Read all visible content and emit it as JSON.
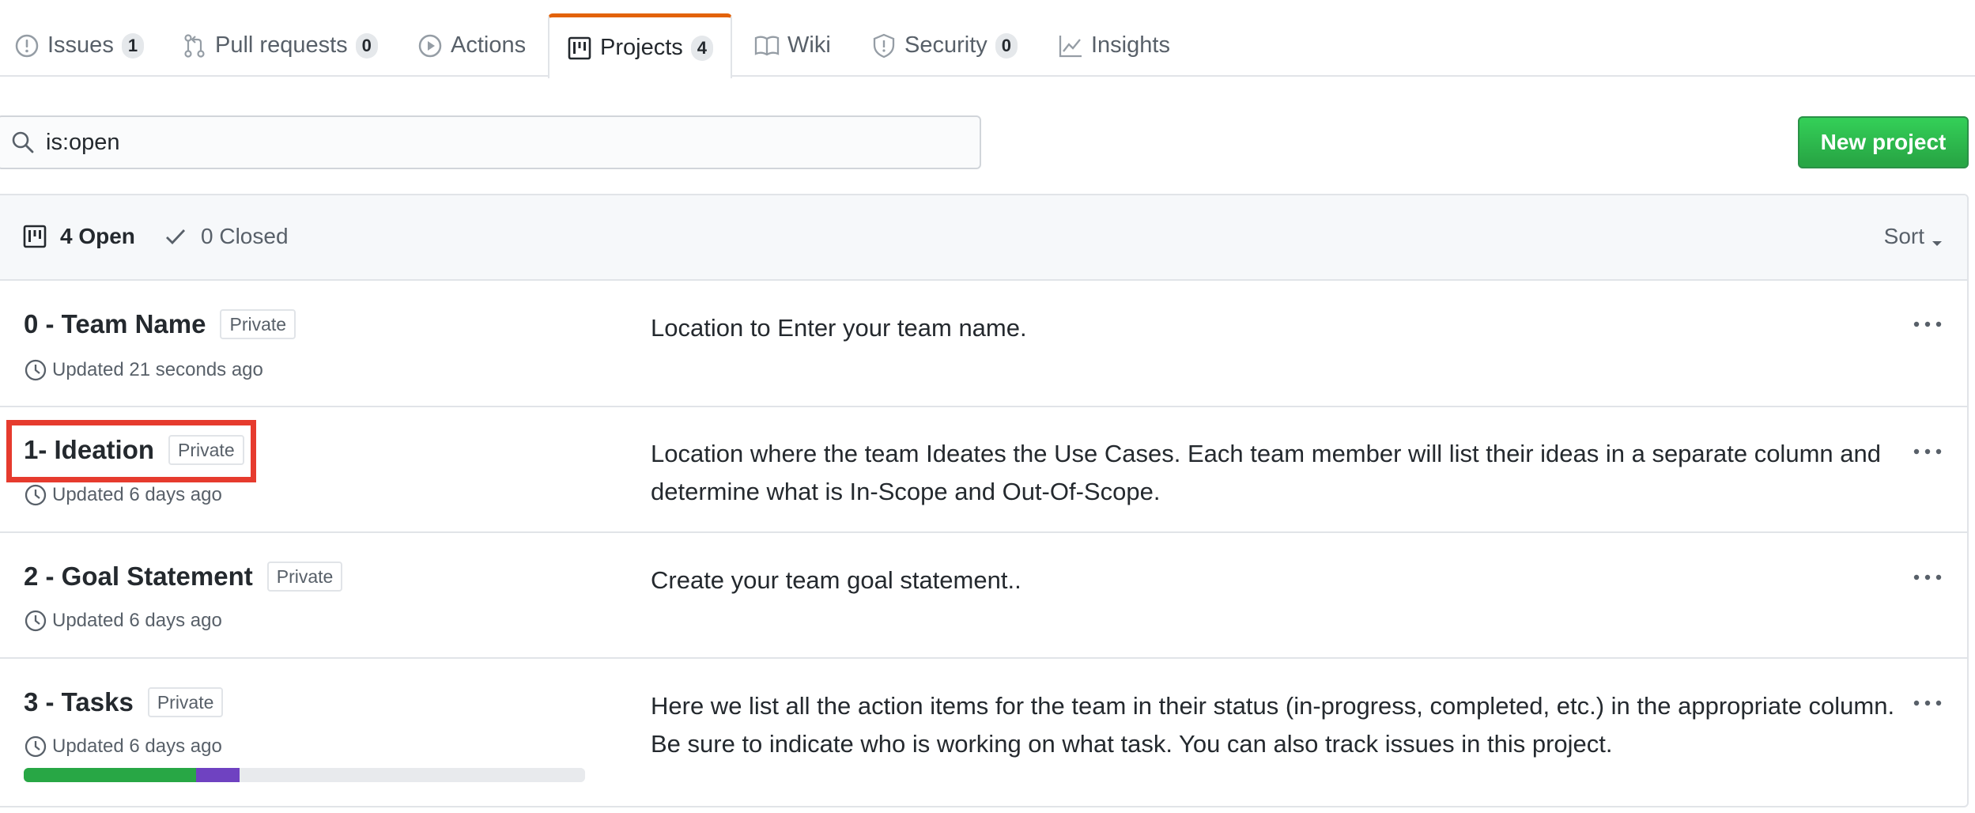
{
  "tabs": [
    {
      "label": "Issues",
      "icon": "issue-opened-icon",
      "count": "1"
    },
    {
      "label": "Pull requests",
      "icon": "git-pull-request-icon",
      "count": "0"
    },
    {
      "label": "Actions",
      "icon": "play-icon",
      "count": null
    },
    {
      "label": "Projects",
      "icon": "project-icon",
      "count": "4",
      "selected": true
    },
    {
      "label": "Wiki",
      "icon": "book-icon",
      "count": null
    },
    {
      "label": "Security",
      "icon": "shield-icon",
      "count": "0"
    },
    {
      "label": "Insights",
      "icon": "graph-icon",
      "count": null
    }
  ],
  "search": {
    "value": "is:open",
    "icon": "search-icon"
  },
  "toolbar": {
    "new_project_label": "New project"
  },
  "list_header": {
    "open_label": "4 Open",
    "closed_label": "0 Closed",
    "sort_label": "Sort"
  },
  "projects": [
    {
      "title": "0 - Team Name",
      "badge": "Private",
      "updated": "Updated 21 seconds ago",
      "description": "Location to Enter your team name."
    },
    {
      "title": "1- Ideation",
      "badge": "Private",
      "updated": "Updated 6 days ago",
      "description": "Location where the team Ideates the Use Cases. Each team member will list their ideas in a separate column and determine what is In-Scope and Out-Of-Scope.",
      "highlighted": true
    },
    {
      "title": "2 - Goal Statement",
      "badge": "Private",
      "updated": "Updated 6 days ago",
      "description": "Create your team goal statement.."
    },
    {
      "title": "3 - Tasks",
      "badge": "Private",
      "updated": "Updated 6 days ago",
      "description": "Here we list all the action items for the team in their status (in-progress, completed, etc.) in the appropriate column. Be sure to indicate who is working on what task. You can also track issues in this project.",
      "progress": {
        "done_percent": 30.7,
        "in_progress_percent": 7.7,
        "todo_percent": 61.6
      }
    }
  ],
  "colors": {
    "accent_tab": "#e36209",
    "primary_button": "#28a745",
    "progress_done": "#28a745",
    "progress_in_progress": "#6f42c1",
    "progress_todo": "#e8eaed",
    "highlight": "#e63b2e"
  }
}
